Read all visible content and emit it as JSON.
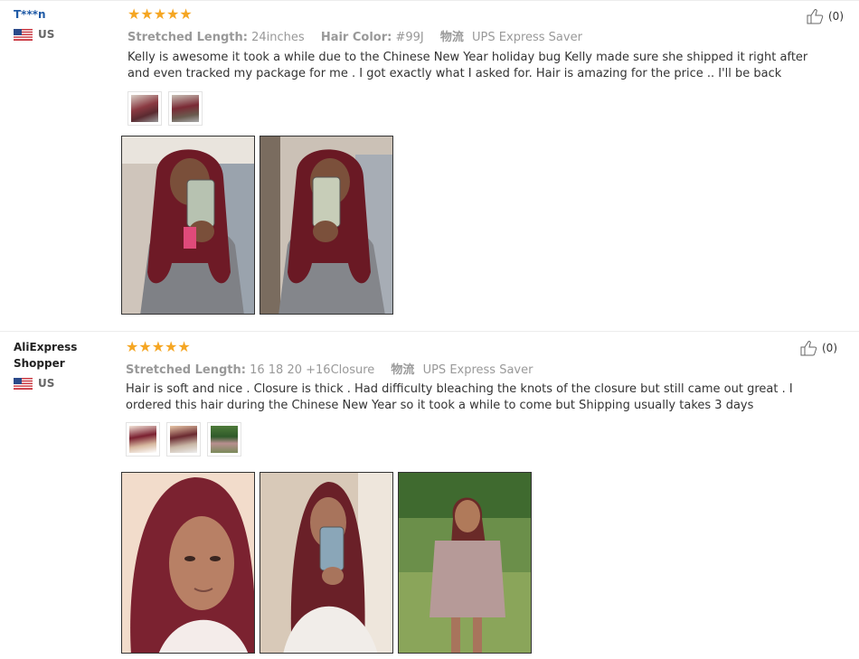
{
  "reviews": [
    {
      "username": "T***n",
      "country": "US",
      "stars": 5,
      "stretched_length_label": "Stretched Length:",
      "stretched_length": "24inches",
      "hair_color_label": "Hair Color:",
      "hair_color": "#99J",
      "shipping_label": "物流",
      "shipping": "UPS Express Saver",
      "text": "Kelly is awesome it took a while due to the Chinese New Year holiday bug Kelly made sure she shipped it right after and even tracked my package for me . I got exactly what I asked for. Hair is amazing for the price .. I'll be back",
      "likes": "(0)",
      "photo_count": 2
    },
    {
      "username": "AliExpress Shopper",
      "country": "US",
      "stars": 5,
      "stretched_length_label": "Stretched Length:",
      "stretched_length": "16 18 20 +16Closure",
      "shipping_label": "物流",
      "shipping": "UPS Express Saver",
      "text": "Hair is soft and nice . Closure is thick . Had difficulty bleaching the knots of the closure but still came out great . I ordered this hair during the Chinese New Year so it took a while to come but Shipping usually takes 3 days",
      "likes": "(0)",
      "photo_count": 3
    }
  ],
  "colors": {
    "star": "#f5a623",
    "username_link": "#1f5aa6",
    "meta_gray": "#999999",
    "hair_burgundy": "#7a1f2e"
  },
  "icons": {
    "like": "thumbs-up-icon",
    "flag": "us-flag-icon",
    "star": "star-icon"
  }
}
